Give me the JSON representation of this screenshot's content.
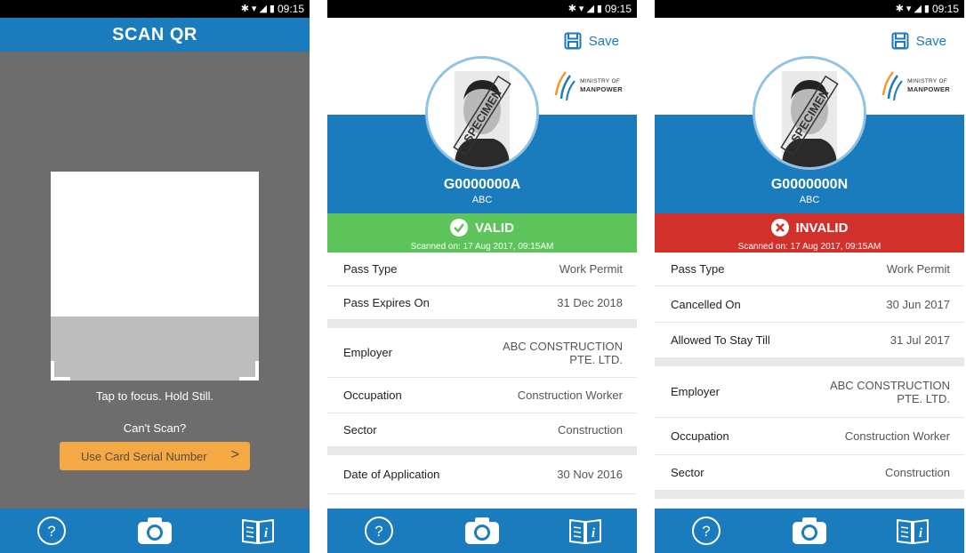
{
  "status_time": "09:15",
  "scan_screen": {
    "title": "SCAN QR",
    "tap_text": "Tap to focus. Hold Still.",
    "cant_scan": "Can't Scan?",
    "serial_button": "Use Card Serial Number"
  },
  "valid_screen": {
    "save_label": "Save",
    "logo_line1": "MINISTRY OF",
    "logo_line2": "MANPOWER",
    "specimen": "SPECIMEN",
    "pass_id": "G0000000A",
    "name": "ABC",
    "status": "VALID",
    "scanned": "Scanned on: 17 Aug 2017, 09:15AM",
    "rows": [
      {
        "label": "Pass Type",
        "value": "Work Permit"
      },
      {
        "label": "Pass Expires On",
        "value": "31 Dec 2018"
      },
      {
        "label": "Employer",
        "value": "ABC CONSTRUCTION PTE. LTD."
      },
      {
        "label": "Occupation",
        "value": "Construction Worker"
      },
      {
        "label": "Sector",
        "value": "Construction"
      },
      {
        "label": "Date of Application",
        "value": "30 Nov 2016"
      }
    ]
  },
  "invalid_screen": {
    "save_label": "Save",
    "logo_line1": "MINISTRY OF",
    "logo_line2": "MANPOWER",
    "specimen": "SPECIMEN",
    "pass_id": "G0000000N",
    "name": "ABC",
    "status": "INVALID",
    "scanned": "Scanned on: 17 Aug 2017, 09:15AM",
    "rows": [
      {
        "label": "Pass Type",
        "value": "Work Permit"
      },
      {
        "label": "Cancelled On",
        "value": "30 Jun 2017"
      },
      {
        "label": "Allowed To Stay Till",
        "value": "31 Jul 2017"
      },
      {
        "label": "Employer",
        "value": "ABC CONSTRUCTION PTE. LTD."
      },
      {
        "label": "Occupation",
        "value": "Construction Worker"
      },
      {
        "label": "Sector",
        "value": "Construction"
      }
    ]
  },
  "icons": {
    "help": "question-circle-icon",
    "camera": "camera-icon",
    "info": "info-book-icon",
    "save": "save-disk-icon",
    "valid": "check-circle-icon",
    "invalid": "x-circle-icon"
  },
  "colors": {
    "brand_blue": "#1a7bbd",
    "valid_green": "#5cc45a",
    "invalid_red": "#d2302b",
    "serial_orange": "#f5a945"
  }
}
